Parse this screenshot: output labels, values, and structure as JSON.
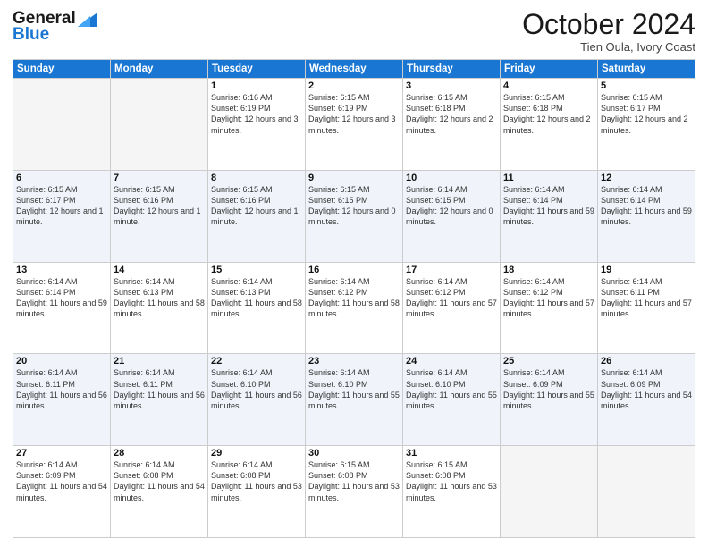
{
  "logo": {
    "line1": "General",
    "line2": "Blue"
  },
  "title": "October 2024",
  "subtitle": "Tien Oula, Ivory Coast",
  "weekdays": [
    "Sunday",
    "Monday",
    "Tuesday",
    "Wednesday",
    "Thursday",
    "Friday",
    "Saturday"
  ],
  "weeks": [
    [
      {
        "day": "",
        "sunrise": "",
        "sunset": "",
        "daylight": ""
      },
      {
        "day": "",
        "sunrise": "",
        "sunset": "",
        "daylight": ""
      },
      {
        "day": "1",
        "sunrise": "Sunrise: 6:16 AM",
        "sunset": "Sunset: 6:19 PM",
        "daylight": "Daylight: 12 hours and 3 minutes."
      },
      {
        "day": "2",
        "sunrise": "Sunrise: 6:15 AM",
        "sunset": "Sunset: 6:19 PM",
        "daylight": "Daylight: 12 hours and 3 minutes."
      },
      {
        "day": "3",
        "sunrise": "Sunrise: 6:15 AM",
        "sunset": "Sunset: 6:18 PM",
        "daylight": "Daylight: 12 hours and 2 minutes."
      },
      {
        "day": "4",
        "sunrise": "Sunrise: 6:15 AM",
        "sunset": "Sunset: 6:18 PM",
        "daylight": "Daylight: 12 hours and 2 minutes."
      },
      {
        "day": "5",
        "sunrise": "Sunrise: 6:15 AM",
        "sunset": "Sunset: 6:17 PM",
        "daylight": "Daylight: 12 hours and 2 minutes."
      }
    ],
    [
      {
        "day": "6",
        "sunrise": "Sunrise: 6:15 AM",
        "sunset": "Sunset: 6:17 PM",
        "daylight": "Daylight: 12 hours and 1 minute."
      },
      {
        "day": "7",
        "sunrise": "Sunrise: 6:15 AM",
        "sunset": "Sunset: 6:16 PM",
        "daylight": "Daylight: 12 hours and 1 minute."
      },
      {
        "day": "8",
        "sunrise": "Sunrise: 6:15 AM",
        "sunset": "Sunset: 6:16 PM",
        "daylight": "Daylight: 12 hours and 1 minute."
      },
      {
        "day": "9",
        "sunrise": "Sunrise: 6:15 AM",
        "sunset": "Sunset: 6:15 PM",
        "daylight": "Daylight: 12 hours and 0 minutes."
      },
      {
        "day": "10",
        "sunrise": "Sunrise: 6:14 AM",
        "sunset": "Sunset: 6:15 PM",
        "daylight": "Daylight: 12 hours and 0 minutes."
      },
      {
        "day": "11",
        "sunrise": "Sunrise: 6:14 AM",
        "sunset": "Sunset: 6:14 PM",
        "daylight": "Daylight: 11 hours and 59 minutes."
      },
      {
        "day": "12",
        "sunrise": "Sunrise: 6:14 AM",
        "sunset": "Sunset: 6:14 PM",
        "daylight": "Daylight: 11 hours and 59 minutes."
      }
    ],
    [
      {
        "day": "13",
        "sunrise": "Sunrise: 6:14 AM",
        "sunset": "Sunset: 6:14 PM",
        "daylight": "Daylight: 11 hours and 59 minutes."
      },
      {
        "day": "14",
        "sunrise": "Sunrise: 6:14 AM",
        "sunset": "Sunset: 6:13 PM",
        "daylight": "Daylight: 11 hours and 58 minutes."
      },
      {
        "day": "15",
        "sunrise": "Sunrise: 6:14 AM",
        "sunset": "Sunset: 6:13 PM",
        "daylight": "Daylight: 11 hours and 58 minutes."
      },
      {
        "day": "16",
        "sunrise": "Sunrise: 6:14 AM",
        "sunset": "Sunset: 6:12 PM",
        "daylight": "Daylight: 11 hours and 58 minutes."
      },
      {
        "day": "17",
        "sunrise": "Sunrise: 6:14 AM",
        "sunset": "Sunset: 6:12 PM",
        "daylight": "Daylight: 11 hours and 57 minutes."
      },
      {
        "day": "18",
        "sunrise": "Sunrise: 6:14 AM",
        "sunset": "Sunset: 6:12 PM",
        "daylight": "Daylight: 11 hours and 57 minutes."
      },
      {
        "day": "19",
        "sunrise": "Sunrise: 6:14 AM",
        "sunset": "Sunset: 6:11 PM",
        "daylight": "Daylight: 11 hours and 57 minutes."
      }
    ],
    [
      {
        "day": "20",
        "sunrise": "Sunrise: 6:14 AM",
        "sunset": "Sunset: 6:11 PM",
        "daylight": "Daylight: 11 hours and 56 minutes."
      },
      {
        "day": "21",
        "sunrise": "Sunrise: 6:14 AM",
        "sunset": "Sunset: 6:11 PM",
        "daylight": "Daylight: 11 hours and 56 minutes."
      },
      {
        "day": "22",
        "sunrise": "Sunrise: 6:14 AM",
        "sunset": "Sunset: 6:10 PM",
        "daylight": "Daylight: 11 hours and 56 minutes."
      },
      {
        "day": "23",
        "sunrise": "Sunrise: 6:14 AM",
        "sunset": "Sunset: 6:10 PM",
        "daylight": "Daylight: 11 hours and 55 minutes."
      },
      {
        "day": "24",
        "sunrise": "Sunrise: 6:14 AM",
        "sunset": "Sunset: 6:10 PM",
        "daylight": "Daylight: 11 hours and 55 minutes."
      },
      {
        "day": "25",
        "sunrise": "Sunrise: 6:14 AM",
        "sunset": "Sunset: 6:09 PM",
        "daylight": "Daylight: 11 hours and 55 minutes."
      },
      {
        "day": "26",
        "sunrise": "Sunrise: 6:14 AM",
        "sunset": "Sunset: 6:09 PM",
        "daylight": "Daylight: 11 hours and 54 minutes."
      }
    ],
    [
      {
        "day": "27",
        "sunrise": "Sunrise: 6:14 AM",
        "sunset": "Sunset: 6:09 PM",
        "daylight": "Daylight: 11 hours and 54 minutes."
      },
      {
        "day": "28",
        "sunrise": "Sunrise: 6:14 AM",
        "sunset": "Sunset: 6:08 PM",
        "daylight": "Daylight: 11 hours and 54 minutes."
      },
      {
        "day": "29",
        "sunrise": "Sunrise: 6:14 AM",
        "sunset": "Sunset: 6:08 PM",
        "daylight": "Daylight: 11 hours and 53 minutes."
      },
      {
        "day": "30",
        "sunrise": "Sunrise: 6:15 AM",
        "sunset": "Sunset: 6:08 PM",
        "daylight": "Daylight: 11 hours and 53 minutes."
      },
      {
        "day": "31",
        "sunrise": "Sunrise: 6:15 AM",
        "sunset": "Sunset: 6:08 PM",
        "daylight": "Daylight: 11 hours and 53 minutes."
      },
      {
        "day": "",
        "sunrise": "",
        "sunset": "",
        "daylight": ""
      },
      {
        "day": "",
        "sunrise": "",
        "sunset": "",
        "daylight": ""
      }
    ]
  ]
}
